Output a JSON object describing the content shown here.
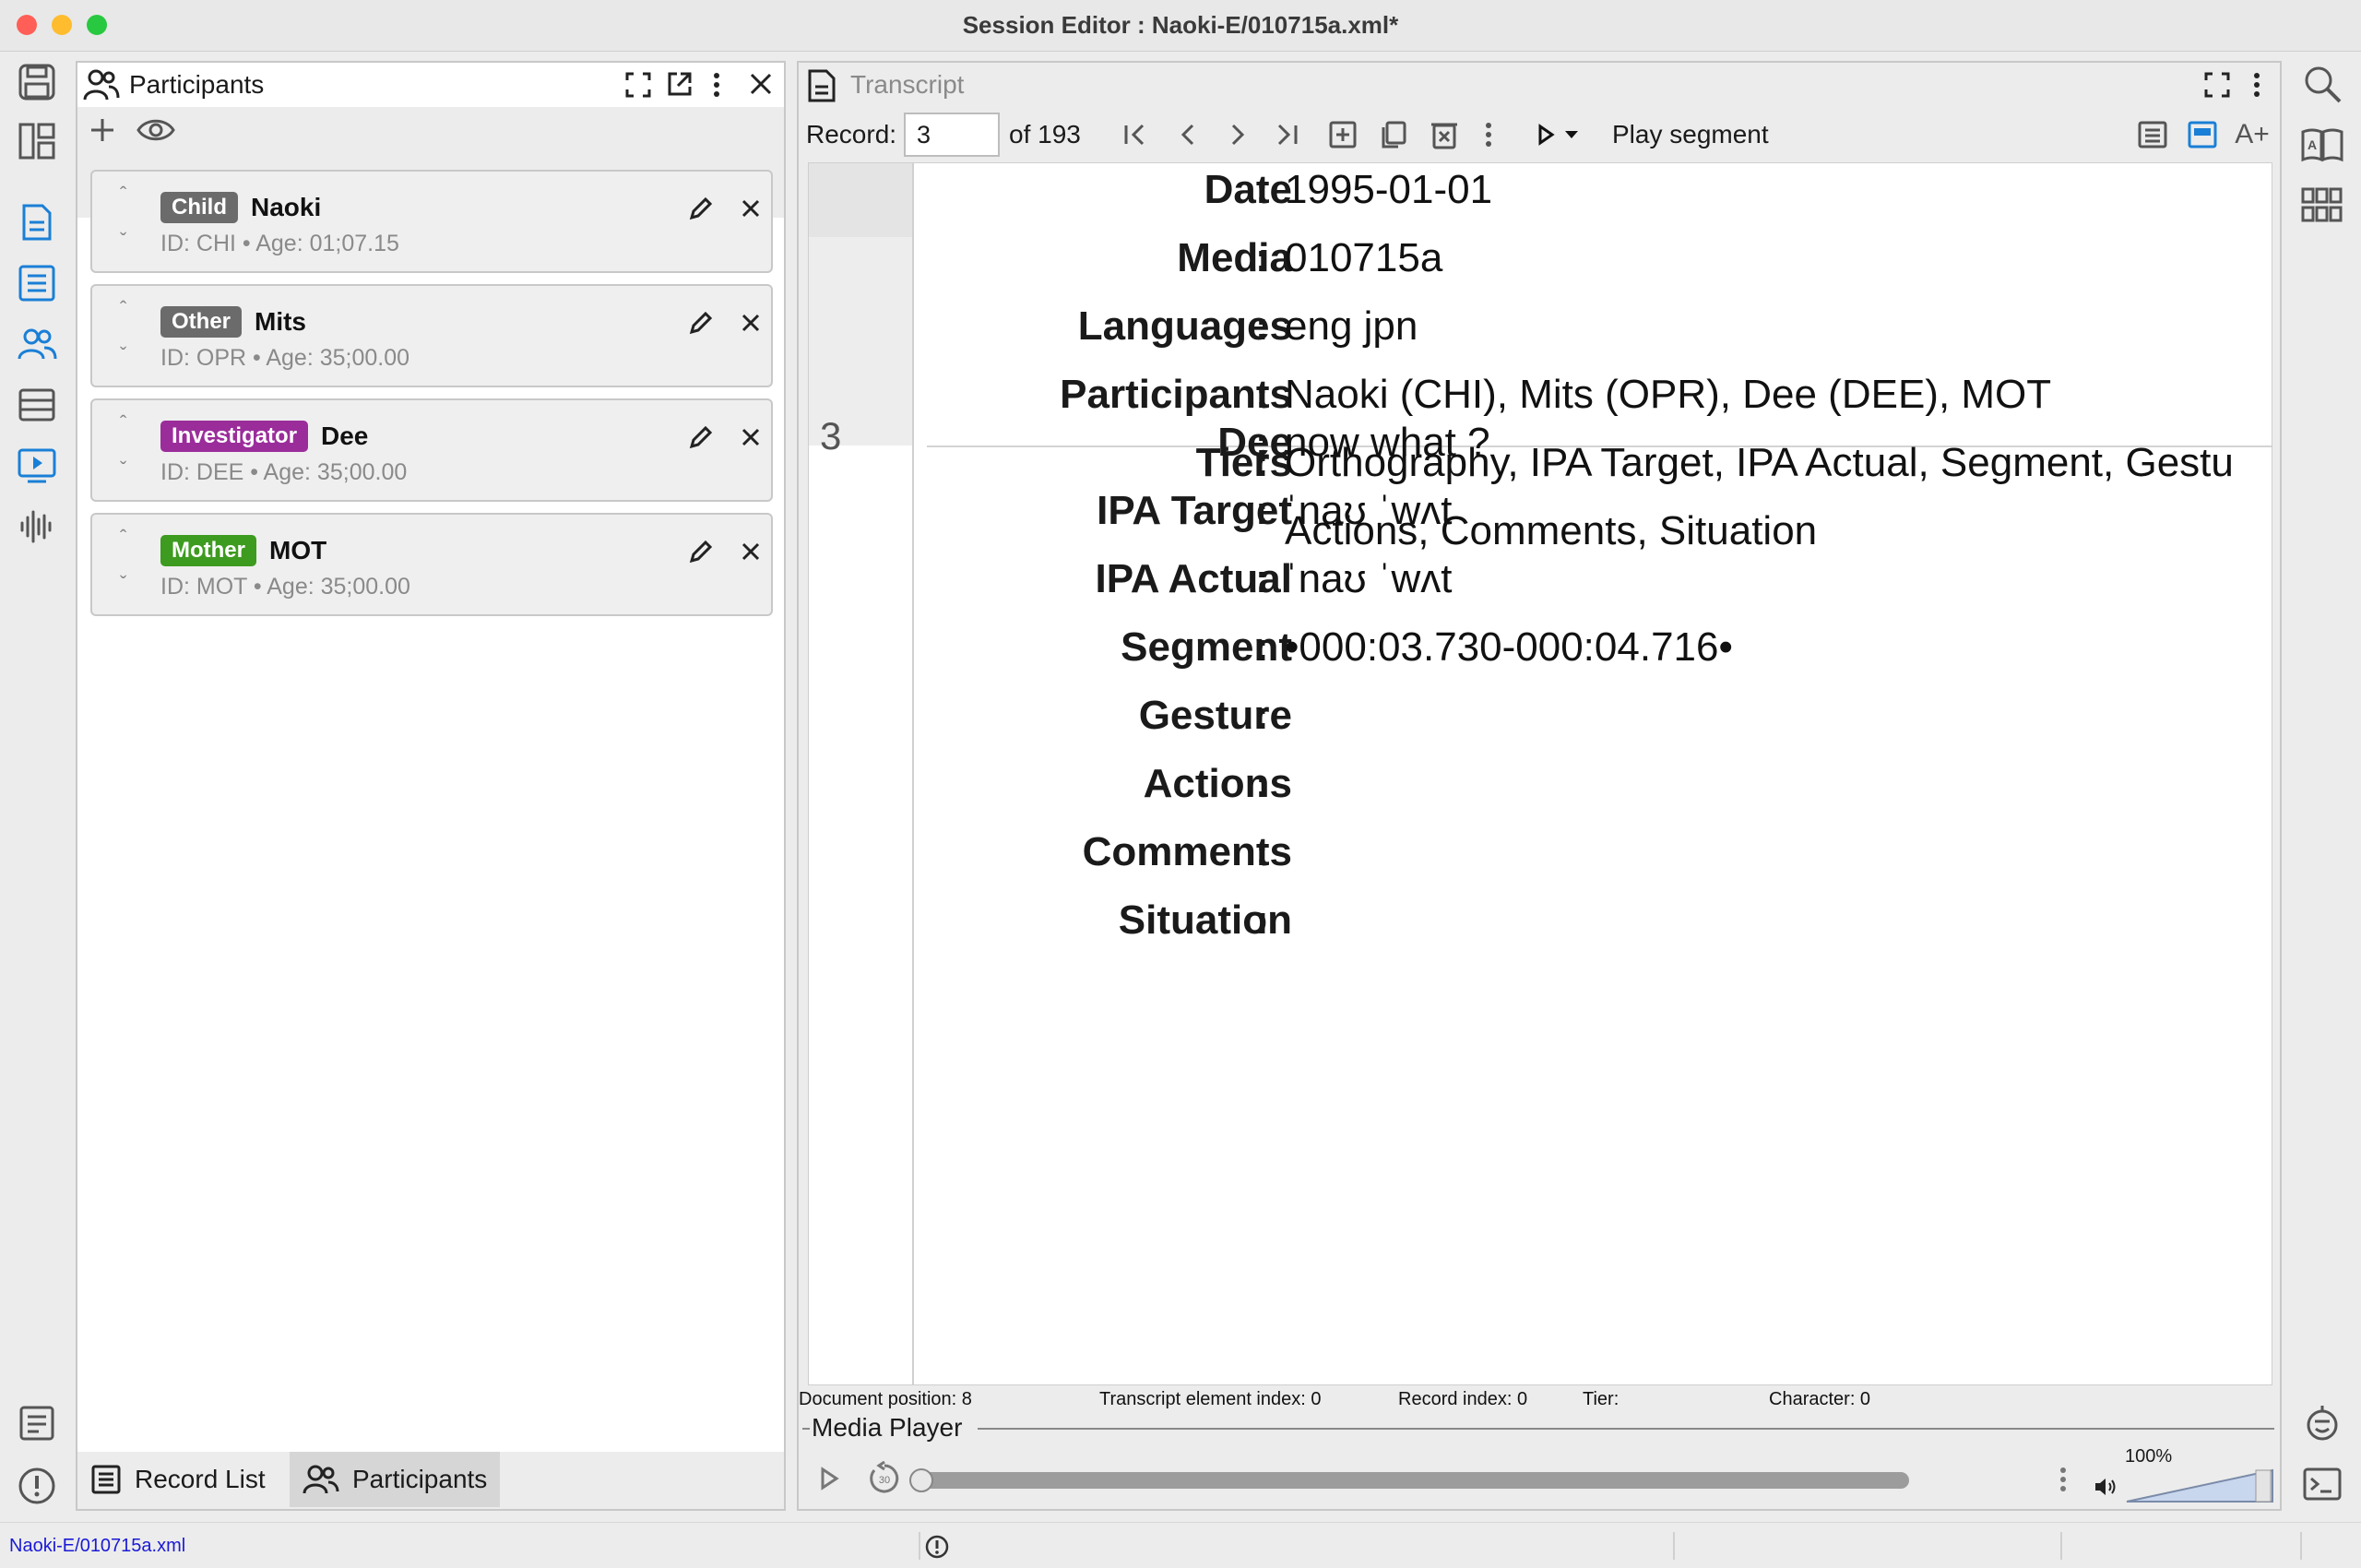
{
  "window": {
    "title": "Session Editor : Naoki-E/010715a.xml*",
    "traffic_colors": [
      "#ff5f57",
      "#febc2e",
      "#28c840"
    ]
  },
  "left_rail": {
    "icons": [
      "save-icon",
      "layout-icon",
      "document-icon",
      "list-icon",
      "participants-icon",
      "records-icon",
      "media-icon",
      "waveform-icon",
      "notes-icon",
      "alert-icon"
    ]
  },
  "right_rail": {
    "icons": [
      "search-icon",
      "dictionary-icon",
      "grid-icon",
      "assistant-icon",
      "terminal-icon"
    ]
  },
  "participants_panel": {
    "title": "Participants",
    "participants": [
      {
        "role": "Child",
        "role_color": "#6b6b6b",
        "name": "Naoki",
        "meta": "ID: CHI  •  Age: 01;07.15"
      },
      {
        "role": "Other",
        "role_color": "#6b6b6b",
        "name": "Mits",
        "meta": "ID: OPR  •  Age: 35;00.00"
      },
      {
        "role": "Investigator",
        "role_color": "#9b2d9b",
        "name": "Dee",
        "meta": "ID: DEE  •  Age: 35;00.00"
      },
      {
        "role": "Mother",
        "role_color": "#3d9b1f",
        "name": "MOT",
        "meta": "ID: MOT  •  Age: 35;00.00"
      }
    ],
    "bottom_tabs": [
      "Record List",
      "Participants"
    ]
  },
  "transcript_panel": {
    "title": "Transcript",
    "record_label": "Record:",
    "record_value": "3",
    "record_total": "of 193",
    "play_label": "Play segment",
    "header_tiers": [
      {
        "label": "Date",
        "value": "1995-01-01"
      },
      {
        "label": "Media",
        "value": "010715a"
      },
      {
        "label": "Languages",
        "value": "eng jpn"
      },
      {
        "label": "Participants",
        "value": "Naoki (CHI), Mits (OPR), Dee (DEE), MOT"
      },
      {
        "label": "Tiers",
        "value": "Orthography, IPA Target, IPA Actual, Segment, Gestu"
      },
      {
        "label": "",
        "value": "Actions, Comments, Situation"
      }
    ],
    "record_number": "3",
    "record_tiers": [
      {
        "label": "Dee",
        "value": "now what ?"
      },
      {
        "label": "IPA Target",
        "value": "ˈnaʊ ˈwʌt"
      },
      {
        "label": "IPA Actual",
        "value": "ˈnaʊ ˈwʌt"
      },
      {
        "label": "Segment",
        "value": "•000:03.730-000:04.716•"
      },
      {
        "label": "Gesture",
        "value": ""
      },
      {
        "label": "Actions",
        "value": ""
      },
      {
        "label": "Comments",
        "value": ""
      },
      {
        "label": "Situation",
        "value": ""
      }
    ],
    "status": {
      "doc_position": "Document position: 8",
      "element_index": "Transcript element index: 0",
      "record_index": "Record index: 0",
      "tier": "Tier:",
      "character": "Character: 0"
    },
    "media_player": {
      "title": "Media Player",
      "volume_label": "100%",
      "volume": 1.0,
      "progress": 0.0
    }
  },
  "statusbar": {
    "file_path": "Naoki-E/010715a.xml"
  }
}
